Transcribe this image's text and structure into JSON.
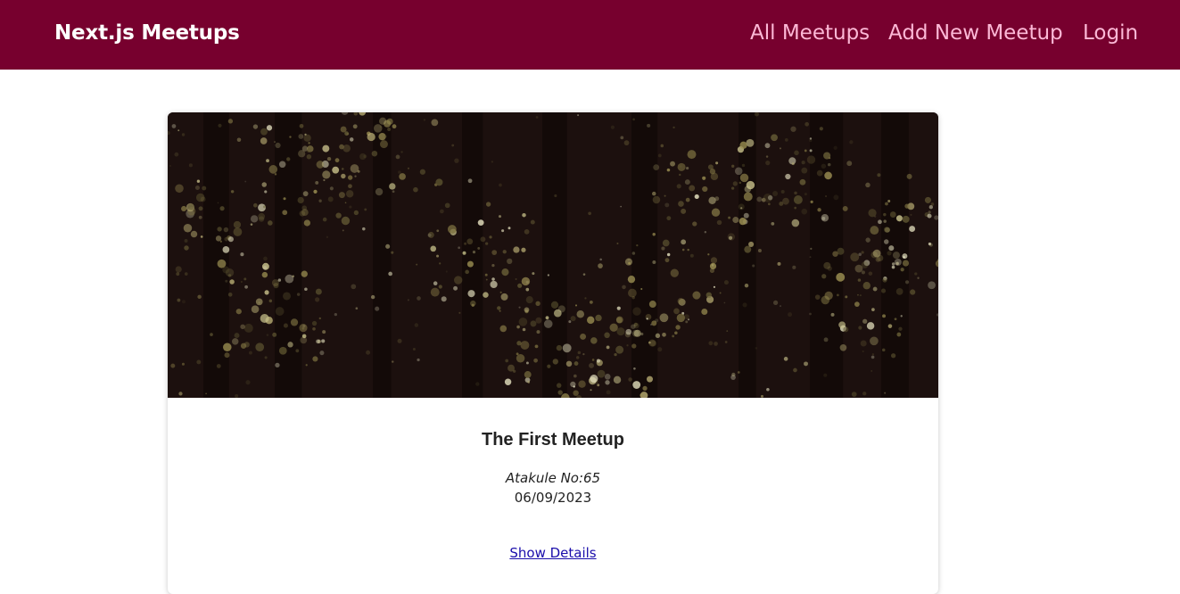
{
  "header": {
    "logo": "Next.js Meetups",
    "nav": {
      "all_meetups": "All Meetups",
      "add_new_meetup": "Add New Meetup",
      "login": "Login"
    }
  },
  "meetup": {
    "title": "The First Meetup",
    "address": "Atakule No:65",
    "date": "06/09/2023",
    "details_link": "Show Details"
  },
  "colors": {
    "header_bg": "#77002e",
    "nav_text": "#fcb8d6",
    "logo_text": "#ffffff",
    "link": "#1a0dab"
  }
}
